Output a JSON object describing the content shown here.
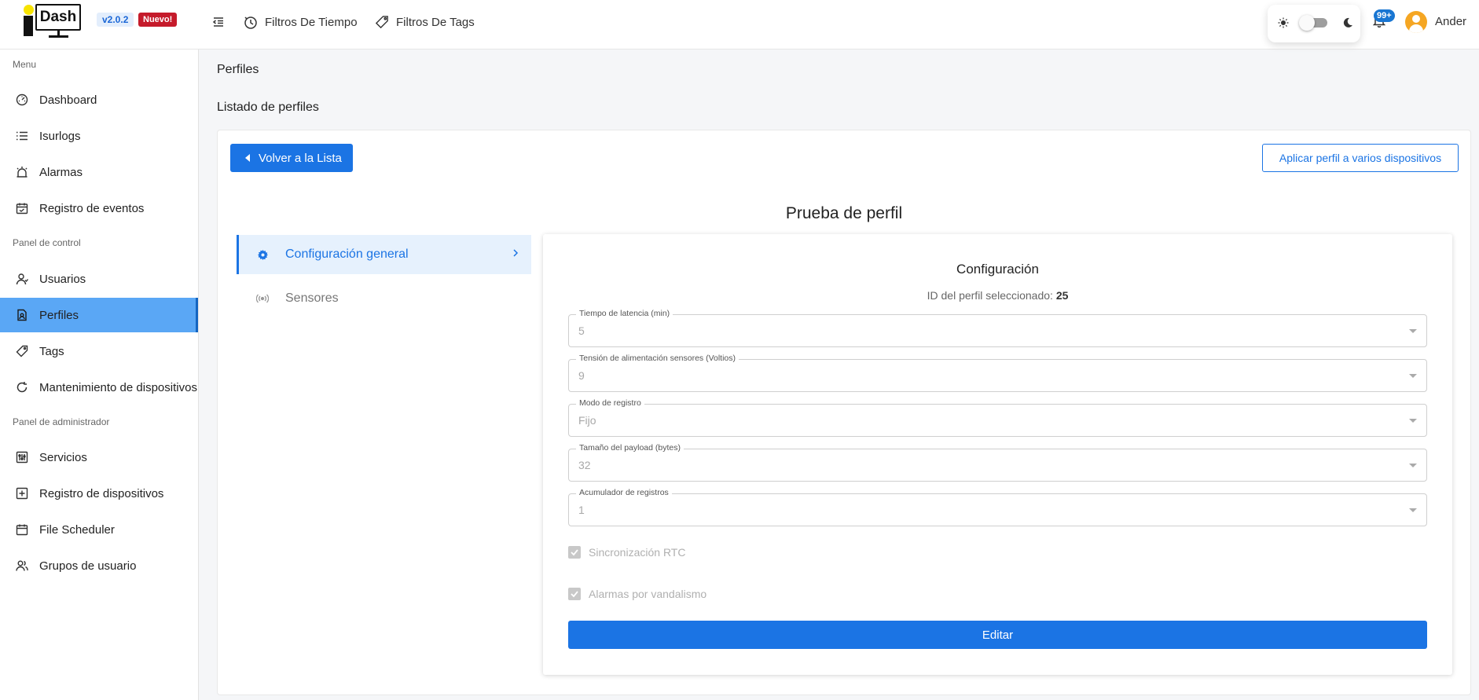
{
  "app": {
    "logo_text": "Dash",
    "version": "v2.0.2",
    "new_badge": "Nuevo!"
  },
  "topbar": {
    "time_filters": "Filtros De Tiempo",
    "tag_filters": "Filtros De Tags",
    "notifications_count": "99+",
    "username": "Ander"
  },
  "sidebar": {
    "sections": [
      {
        "label": "Menu"
      },
      {
        "label": "Panel de control"
      },
      {
        "label": "Panel de administrador"
      }
    ],
    "items": [
      {
        "label": "Dashboard",
        "icon": "gauge-icon"
      },
      {
        "label": "Isurlogs",
        "icon": "list-icon"
      },
      {
        "label": "Alarmas",
        "icon": "alarm-icon"
      },
      {
        "label": "Registro de eventos",
        "icon": "calendar-check-icon"
      },
      {
        "label": "Usuarios",
        "icon": "user-icon"
      },
      {
        "label": "Perfiles",
        "icon": "profile-doc-icon",
        "active": true
      },
      {
        "label": "Tags",
        "icon": "tag-icon"
      },
      {
        "label": "Mantenimiento de dispositivos",
        "icon": "refresh-icon"
      },
      {
        "label": "Servicios",
        "icon": "sliders-icon"
      },
      {
        "label": "Registro de dispositivos",
        "icon": "plus-square-icon"
      },
      {
        "label": "File Scheduler",
        "icon": "calendar-icon"
      },
      {
        "label": "Grupos de usuario",
        "icon": "users-icon"
      }
    ]
  },
  "main": {
    "page_title": "Perfiles",
    "list_title": "Listado de perfiles",
    "back_button": "Volver a la Lista",
    "apply_button": "Aplicar perfil a varios dispositivos",
    "profile_name": "Prueba de perfil",
    "tabs": [
      {
        "label": "Configuración general",
        "active": true
      },
      {
        "label": "Sensores",
        "active": false
      }
    ],
    "config": {
      "title": "Configuración",
      "id_label": "ID del perfil seleccionado:",
      "id_value": "25",
      "fields": [
        {
          "label": "Tiempo de latencia (min)",
          "value": "5"
        },
        {
          "label": "Tensión de alimentación sensores (Voltios)",
          "value": "9"
        },
        {
          "label": "Modo de registro",
          "value": "Fijo"
        },
        {
          "label": "Tamaño del payload (bytes)",
          "value": "32"
        },
        {
          "label": "Acumulador de registros",
          "value": "1"
        }
      ],
      "checkboxes": [
        {
          "label": "Sincronización RTC",
          "checked": true
        },
        {
          "label": "Alarmas por vandalismo",
          "checked": true
        }
      ],
      "edit_button": "Editar"
    }
  },
  "colors": {
    "primary": "#1b74e4",
    "sidebar_active": "#5aa7f5",
    "new_badge": "#c51b2b"
  }
}
